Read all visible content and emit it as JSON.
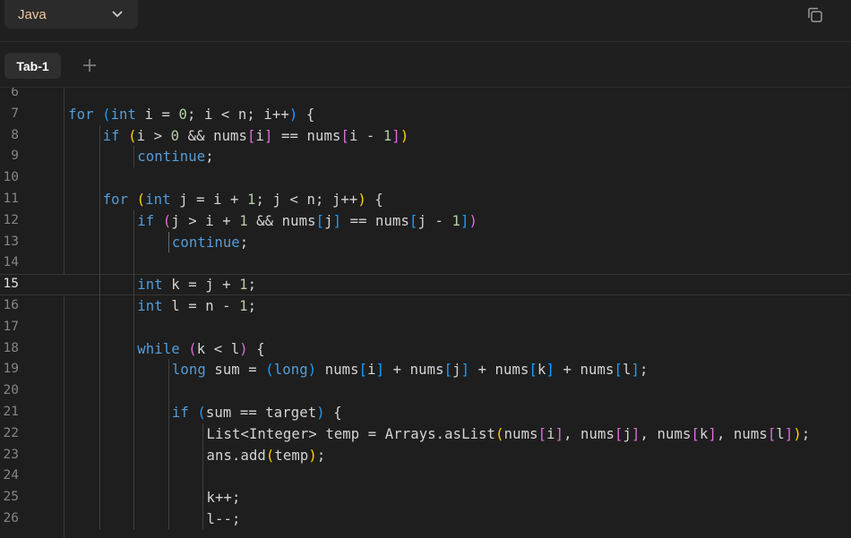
{
  "header": {
    "language": "Java",
    "copy_icon": "copy-icon",
    "chevron_icon": "chevron-down-icon"
  },
  "tabs": [
    {
      "label": "Tab-1",
      "active": true
    }
  ],
  "add_tab_icon": "plus-icon",
  "editor": {
    "current_line": "15",
    "lines": [
      {
        "n": "6",
        "indent": 0,
        "tokens": []
      },
      {
        "n": "7",
        "indent": 1,
        "tokens": [
          {
            "t": "for",
            "c": "kw"
          },
          {
            "t": " ",
            "c": "tx"
          },
          {
            "t": "(",
            "c": "p3"
          },
          {
            "t": "int",
            "c": "kw"
          },
          {
            "t": " i = ",
            "c": "tx"
          },
          {
            "t": "0",
            "c": "nm"
          },
          {
            "t": "; i < n; i++",
            "c": "tx"
          },
          {
            "t": ")",
            "c": "p3"
          },
          {
            "t": " {",
            "c": "tx"
          }
        ]
      },
      {
        "n": "8",
        "indent": 2,
        "tokens": [
          {
            "t": "if",
            "c": "kw"
          },
          {
            "t": " ",
            "c": "tx"
          },
          {
            "t": "(",
            "c": "p1"
          },
          {
            "t": "i > ",
            "c": "tx"
          },
          {
            "t": "0",
            "c": "nm"
          },
          {
            "t": " && nums",
            "c": "tx"
          },
          {
            "t": "[",
            "c": "p2"
          },
          {
            "t": "i",
            "c": "tx"
          },
          {
            "t": "]",
            "c": "p2"
          },
          {
            "t": " == nums",
            "c": "tx"
          },
          {
            "t": "[",
            "c": "p2"
          },
          {
            "t": "i - ",
            "c": "tx"
          },
          {
            "t": "1",
            "c": "nm"
          },
          {
            "t": "]",
            "c": "p2"
          },
          {
            "t": ")",
            "c": "p1"
          }
        ]
      },
      {
        "n": "9",
        "indent": 3,
        "tokens": [
          {
            "t": "continue",
            "c": "kw"
          },
          {
            "t": ";",
            "c": "tx"
          }
        ]
      },
      {
        "n": "10",
        "indent": 2,
        "tokens": []
      },
      {
        "n": "11",
        "indent": 2,
        "tokens": [
          {
            "t": "for",
            "c": "kw"
          },
          {
            "t": " ",
            "c": "tx"
          },
          {
            "t": "(",
            "c": "p1"
          },
          {
            "t": "int",
            "c": "kw"
          },
          {
            "t": " j = i + ",
            "c": "tx"
          },
          {
            "t": "1",
            "c": "nm"
          },
          {
            "t": "; j < n; j++",
            "c": "tx"
          },
          {
            "t": ")",
            "c": "p1"
          },
          {
            "t": " {",
            "c": "tx"
          }
        ]
      },
      {
        "n": "12",
        "indent": 3,
        "tokens": [
          {
            "t": "if",
            "c": "kw"
          },
          {
            "t": " ",
            "c": "tx"
          },
          {
            "t": "(",
            "c": "p2"
          },
          {
            "t": "j > i + ",
            "c": "tx"
          },
          {
            "t": "1",
            "c": "nm"
          },
          {
            "t": " && nums",
            "c": "tx"
          },
          {
            "t": "[",
            "c": "p3"
          },
          {
            "t": "j",
            "c": "tx"
          },
          {
            "t": "]",
            "c": "p3"
          },
          {
            "t": " == nums",
            "c": "tx"
          },
          {
            "t": "[",
            "c": "p3"
          },
          {
            "t": "j - ",
            "c": "tx"
          },
          {
            "t": "1",
            "c": "nm"
          },
          {
            "t": "]",
            "c": "p3"
          },
          {
            "t": ")",
            "c": "p2"
          }
        ]
      },
      {
        "n": "13",
        "indent": 4,
        "tokens": [
          {
            "t": "continue",
            "c": "kw"
          },
          {
            "t": ";",
            "c": "tx"
          }
        ]
      },
      {
        "n": "14",
        "indent": 3,
        "tokens": []
      },
      {
        "n": "15",
        "indent": 3,
        "tokens": [
          {
            "t": "int",
            "c": "kw"
          },
          {
            "t": " k = j + ",
            "c": "tx"
          },
          {
            "t": "1",
            "c": "nm"
          },
          {
            "t": ";",
            "c": "tx"
          }
        ]
      },
      {
        "n": "16",
        "indent": 3,
        "tokens": [
          {
            "t": "int",
            "c": "kw"
          },
          {
            "t": " l = n - ",
            "c": "tx"
          },
          {
            "t": "1",
            "c": "nm"
          },
          {
            "t": ";",
            "c": "tx"
          }
        ]
      },
      {
        "n": "17",
        "indent": 3,
        "tokens": []
      },
      {
        "n": "18",
        "indent": 3,
        "tokens": [
          {
            "t": "while",
            "c": "kw"
          },
          {
            "t": " ",
            "c": "tx"
          },
          {
            "t": "(",
            "c": "p2"
          },
          {
            "t": "k < l",
            "c": "tx"
          },
          {
            "t": ")",
            "c": "p2"
          },
          {
            "t": " {",
            "c": "tx"
          }
        ]
      },
      {
        "n": "19",
        "indent": 4,
        "tokens": [
          {
            "t": "long",
            "c": "kw"
          },
          {
            "t": " sum = ",
            "c": "tx"
          },
          {
            "t": "(",
            "c": "p3"
          },
          {
            "t": "long",
            "c": "kw"
          },
          {
            "t": ")",
            "c": "p3"
          },
          {
            "t": " nums",
            "c": "tx"
          },
          {
            "t": "[",
            "c": "p3"
          },
          {
            "t": "i",
            "c": "tx"
          },
          {
            "t": "]",
            "c": "p3"
          },
          {
            "t": " + nums",
            "c": "tx"
          },
          {
            "t": "[",
            "c": "p3"
          },
          {
            "t": "j",
            "c": "tx"
          },
          {
            "t": "]",
            "c": "p3"
          },
          {
            "t": " + nums",
            "c": "tx"
          },
          {
            "t": "[",
            "c": "p3"
          },
          {
            "t": "k",
            "c": "tx"
          },
          {
            "t": "]",
            "c": "p3"
          },
          {
            "t": " + nums",
            "c": "tx"
          },
          {
            "t": "[",
            "c": "p3"
          },
          {
            "t": "l",
            "c": "tx"
          },
          {
            "t": "]",
            "c": "p3"
          },
          {
            "t": ";",
            "c": "tx"
          }
        ]
      },
      {
        "n": "20",
        "indent": 4,
        "tokens": []
      },
      {
        "n": "21",
        "indent": 4,
        "tokens": [
          {
            "t": "if",
            "c": "kw"
          },
          {
            "t": " ",
            "c": "tx"
          },
          {
            "t": "(",
            "c": "p3"
          },
          {
            "t": "sum == target",
            "c": "tx"
          },
          {
            "t": ")",
            "c": "p3"
          },
          {
            "t": " {",
            "c": "tx"
          }
        ]
      },
      {
        "n": "22",
        "indent": 5,
        "tokens": [
          {
            "t": "List<Integer> temp = Arrays.asList",
            "c": "tx"
          },
          {
            "t": "(",
            "c": "p1"
          },
          {
            "t": "nums",
            "c": "tx"
          },
          {
            "t": "[",
            "c": "p2"
          },
          {
            "t": "i",
            "c": "tx"
          },
          {
            "t": "]",
            "c": "p2"
          },
          {
            "t": ", nums",
            "c": "tx"
          },
          {
            "t": "[",
            "c": "p2"
          },
          {
            "t": "j",
            "c": "tx"
          },
          {
            "t": "]",
            "c": "p2"
          },
          {
            "t": ", nums",
            "c": "tx"
          },
          {
            "t": "[",
            "c": "p2"
          },
          {
            "t": "k",
            "c": "tx"
          },
          {
            "t": "]",
            "c": "p2"
          },
          {
            "t": ", nums",
            "c": "tx"
          },
          {
            "t": "[",
            "c": "p2"
          },
          {
            "t": "l",
            "c": "tx"
          },
          {
            "t": "]",
            "c": "p2"
          },
          {
            "t": ")",
            "c": "p1"
          },
          {
            "t": ";",
            "c": "tx"
          }
        ]
      },
      {
        "n": "23",
        "indent": 5,
        "tokens": [
          {
            "t": "ans.add",
            "c": "tx"
          },
          {
            "t": "(",
            "c": "p1"
          },
          {
            "t": "temp",
            "c": "tx"
          },
          {
            "t": ")",
            "c": "p1"
          },
          {
            "t": ";",
            "c": "tx"
          }
        ]
      },
      {
        "n": "24",
        "indent": 5,
        "tokens": []
      },
      {
        "n": "25",
        "indent": 5,
        "tokens": [
          {
            "t": "k++;",
            "c": "tx"
          }
        ]
      },
      {
        "n": "26",
        "indent": 5,
        "tokens": [
          {
            "t": "l--;",
            "c": "tx"
          }
        ]
      }
    ]
  }
}
